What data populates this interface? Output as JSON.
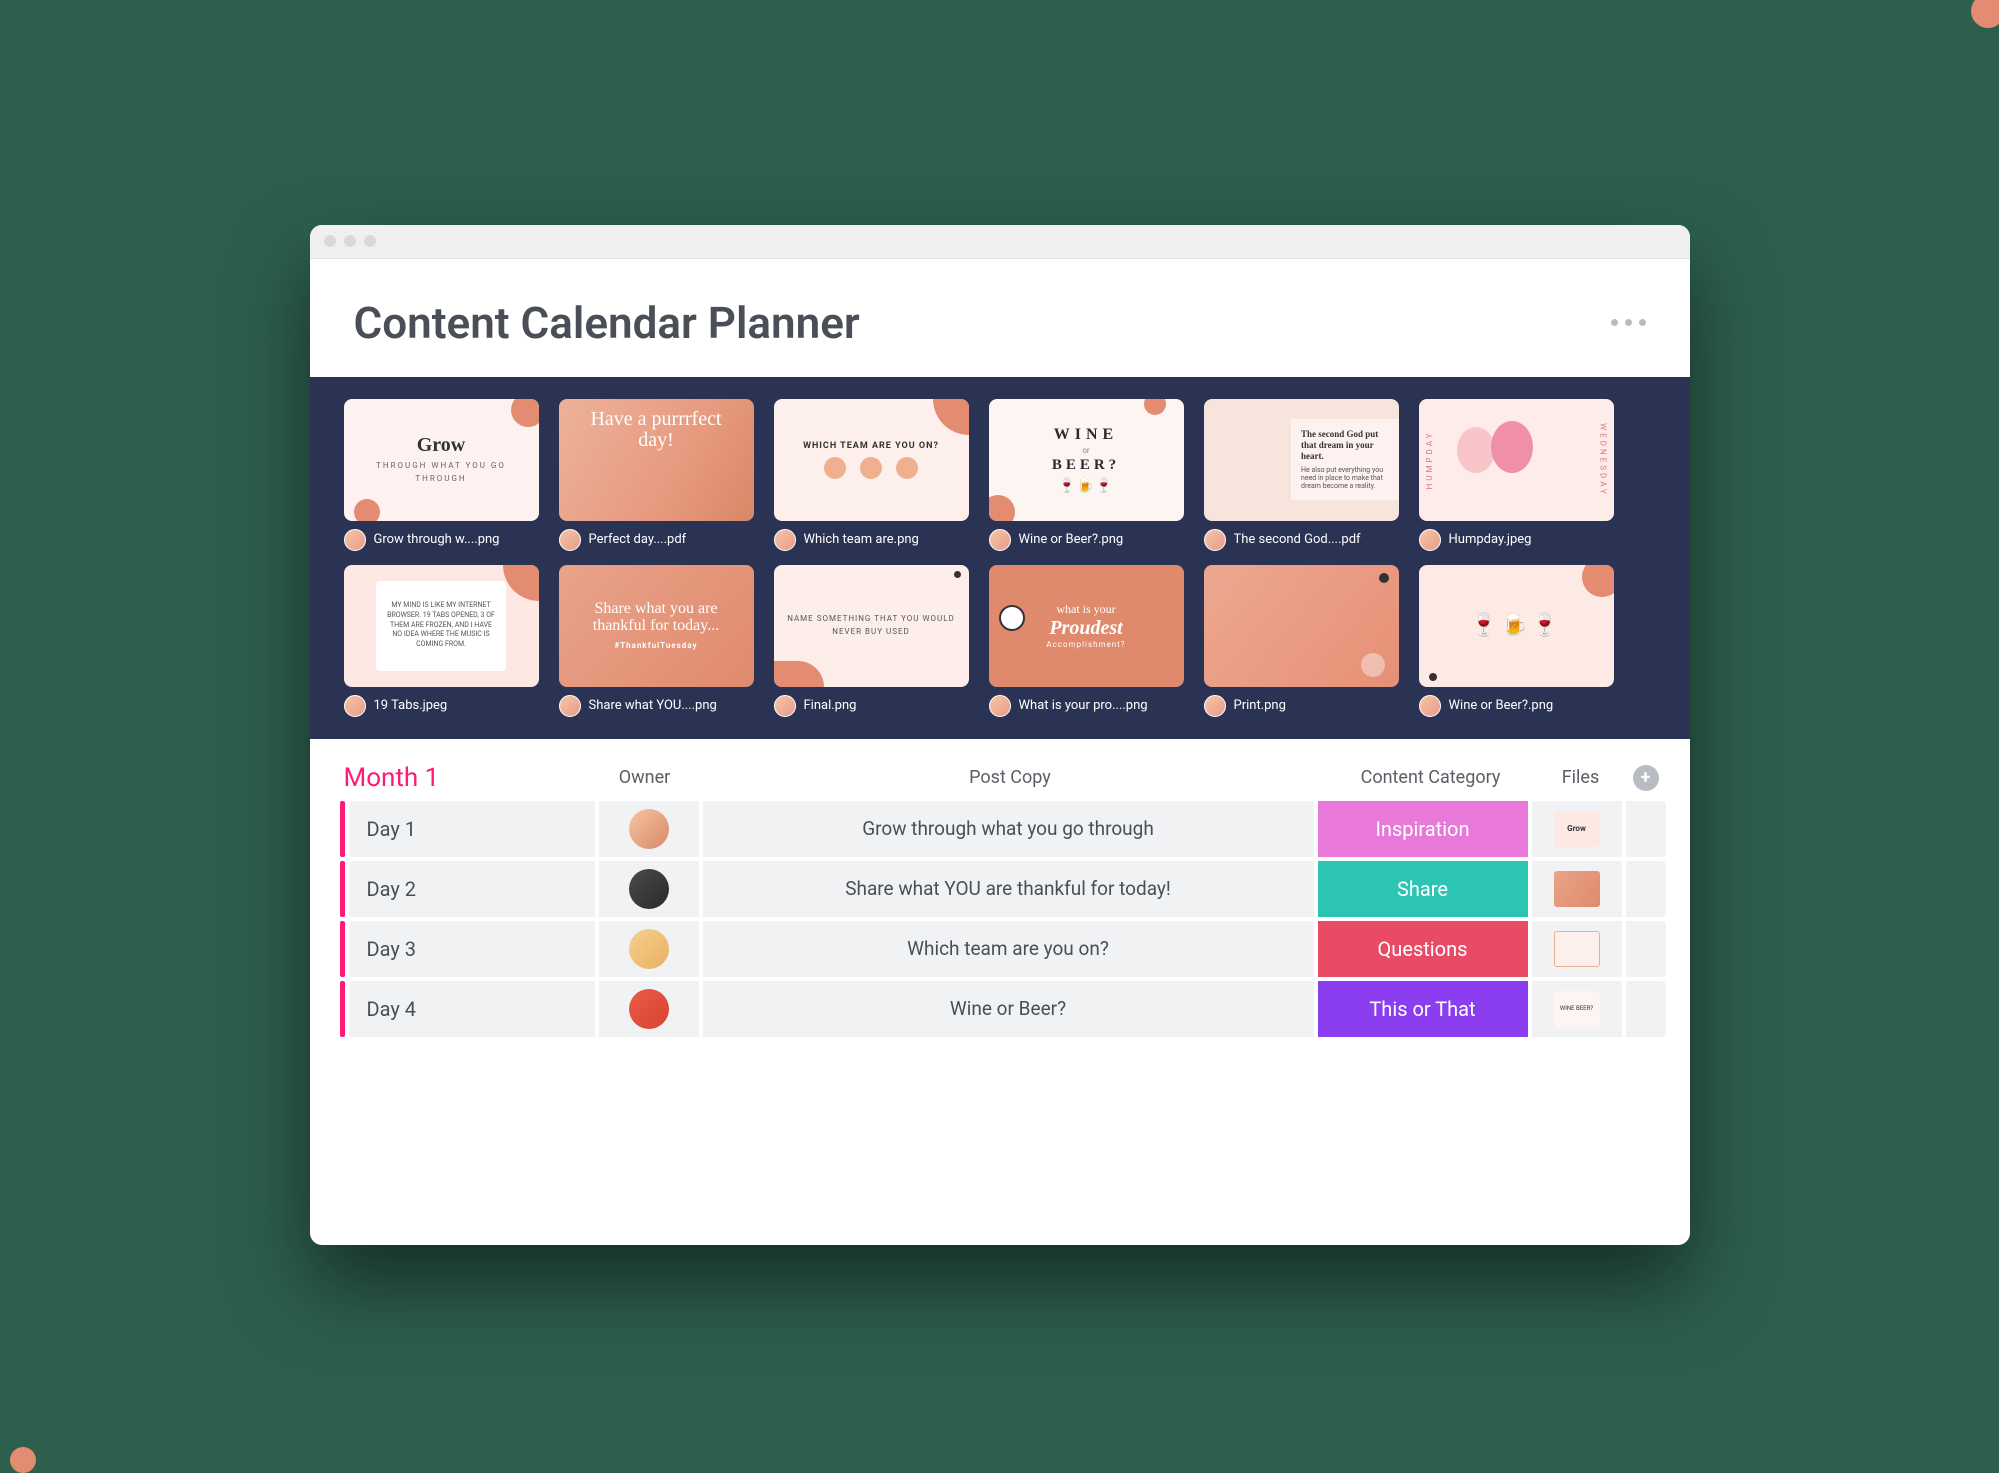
{
  "header": {
    "title": "Content Calendar Planner"
  },
  "gallery": {
    "row1": [
      {
        "filename": "Grow through w....png"
      },
      {
        "filename": "Perfect day....pdf"
      },
      {
        "filename": "Which team are.png"
      },
      {
        "filename": "Wine or Beer?.png"
      },
      {
        "filename": "The second God....pdf"
      },
      {
        "filename": "Humpday.jpeg"
      }
    ],
    "row2": [
      {
        "filename": "19 Tabs.jpeg"
      },
      {
        "filename": "Share what YOU....png"
      },
      {
        "filename": "Final.png"
      },
      {
        "filename": "What is your pro....png"
      },
      {
        "filename": "Print.png"
      },
      {
        "filename": "Wine or Beer?.png"
      }
    ]
  },
  "thumb_text": {
    "grow_big": "Grow",
    "grow_small": "THROUGH WHAT YOU GO THROUGH",
    "perfect": "Have a purrrfect day!",
    "team_title": "WHICH TEAM ARE YOU ON?",
    "wine_1": "WINE",
    "wine_or": "or",
    "wine_2": "BEER?",
    "god_bold": "The second God put that dream in your heart.",
    "god_body": "He also put everything you need in place to make that dream become a reality.",
    "hump_side": "HUMPDAY",
    "hump_side2": "WEDNESDAY",
    "tabs": "MY MIND IS LIKE MY INTERNET BROWSER. 19 TABS OPENED, 3 OF THEM ARE FROZEN, AND I HAVE NO IDEA WHERE THE MUSIC IS COMING FROM.",
    "share_script": "Share what you are thankful for today...",
    "share_tag": "#ThankfulTuesday",
    "final": "NAME SOMETHING THAT YOU WOULD NEVER BUY USED",
    "proud_1": "what is your",
    "proud_2": "Proudest",
    "proud_3": "Accomplishment?"
  },
  "table": {
    "section_label": "Month 1",
    "columns": {
      "owner": "Owner",
      "post_copy": "Post Copy",
      "content_category": "Content Category",
      "files": "Files"
    },
    "rows": [
      {
        "day": "Day 1",
        "copy": "Grow through what you go through",
        "category": "Inspiration",
        "cat_color": "#e879d9",
        "mini": "Grow"
      },
      {
        "day": "Day 2",
        "copy": "Share what YOU are thankful for today!",
        "category": "Share",
        "cat_color": "#2cc5b4",
        "mini": ""
      },
      {
        "day": "Day 3",
        "copy": "Which team are you on?",
        "category": "Questions",
        "cat_color": "#e94b66",
        "mini": ""
      },
      {
        "day": "Day 4",
        "copy": "Wine or Beer?",
        "category": "This or That",
        "cat_color": "#8a3ef0",
        "mini": "WINE BEER?"
      }
    ]
  }
}
